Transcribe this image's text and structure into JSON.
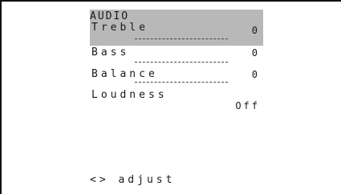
{
  "menu": {
    "title": "AUDIO",
    "items": [
      {
        "label": "Treble",
        "value": "0",
        "selected": true,
        "level": 0.5
      },
      {
        "label": "Bass",
        "value": "0",
        "selected": false,
        "level": 0.5
      },
      {
        "label": "Balance",
        "value": "0",
        "selected": false,
        "level": 0.5
      },
      {
        "label": "Loudness",
        "value": "Off",
        "selected": false
      }
    ]
  },
  "help": {
    "text": "<> adjust"
  },
  "colors": {
    "selection": "#b8b8b8",
    "text": "#1a1a1a",
    "background": "#ffffff"
  }
}
